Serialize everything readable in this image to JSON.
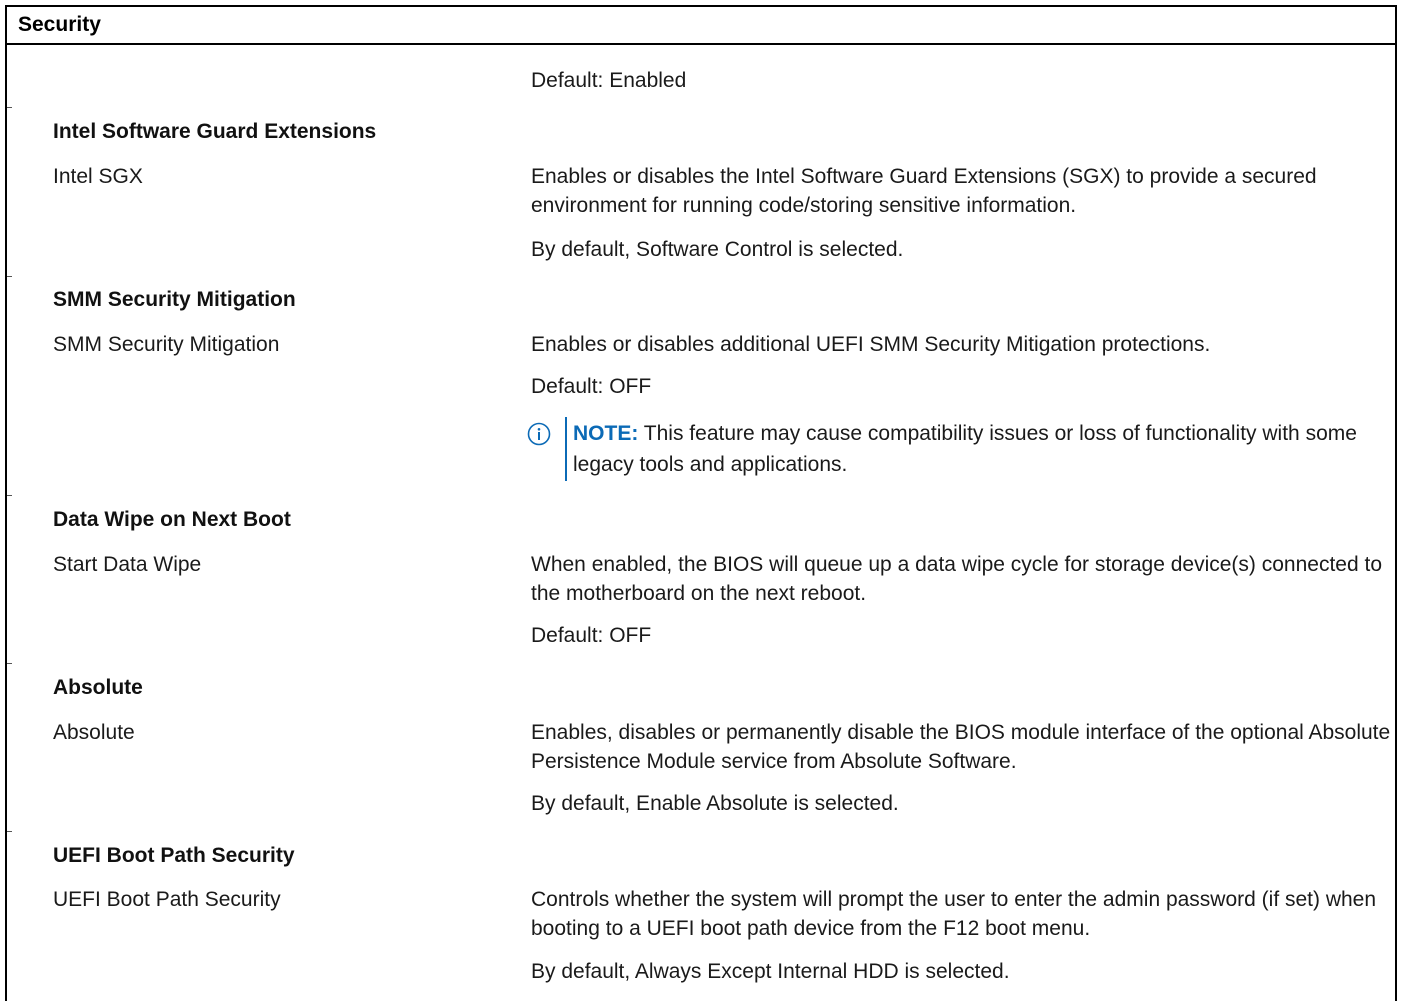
{
  "header": {
    "title": "Security"
  },
  "top_default": "Default: Enabled",
  "sections": {
    "sgx": {
      "title": "Intel Software Guard Extensions",
      "option": "Intel SGX",
      "description": "Enables or disables the Intel Software Guard Extensions (SGX) to provide a secured environment for running code/storing sensitive information.",
      "default": "By default, Software Control is selected."
    },
    "smm": {
      "title": "SMM Security Mitigation",
      "option": "SMM Security Mitigation",
      "description": "Enables or disables additional UEFI SMM Security Mitigation protections.",
      "default": "Default: OFF",
      "note_label": "NOTE:",
      "note_text": "This feature may cause compatibility issues or loss of functionality with some legacy tools and applications."
    },
    "wipe": {
      "title": "Data Wipe on Next Boot",
      "option": "Start Data Wipe",
      "description": "When enabled, the BIOS will queue up a data wipe cycle for storage device(s) connected to the motherboard on the next reboot.",
      "default": "Default: OFF"
    },
    "absolute": {
      "title": "Absolute",
      "option": "Absolute",
      "description": "Enables, disables or permanently disable the BIOS module interface of the optional Absolute Persistence Module service from Absolute Software.",
      "default": "By default, Enable Absolute is selected."
    },
    "uefi": {
      "title": "UEFI Boot Path Security",
      "option": "UEFI Boot Path Security",
      "description": "Controls whether the system will prompt the user to enter the admin password (if set) when booting to a UEFI boot path device from the F12 boot menu.",
      "default": "By default, Always Except Internal HDD is selected."
    }
  },
  "colors": {
    "note_accent": "#0b6ab6",
    "border": "#000000"
  },
  "icons": {
    "note": "info-circle-icon"
  }
}
